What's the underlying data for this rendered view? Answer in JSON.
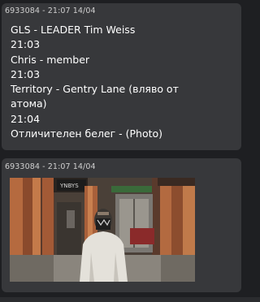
{
  "messages": [
    {
      "meta": "6933084 - 21:07 14/04",
      "lines": [
        "GLS - LEADER Tim Weiss",
        "21:03",
        "Chris - member",
        "21:03",
        "Territory - Gentry Lane (вляво от",
        "атома)",
        "21:04",
        "Отличителен белег - (Photo)"
      ]
    },
    {
      "meta": "6933084 - 21:07 14/04",
      "photo_sign": "YNBYS"
    }
  ]
}
